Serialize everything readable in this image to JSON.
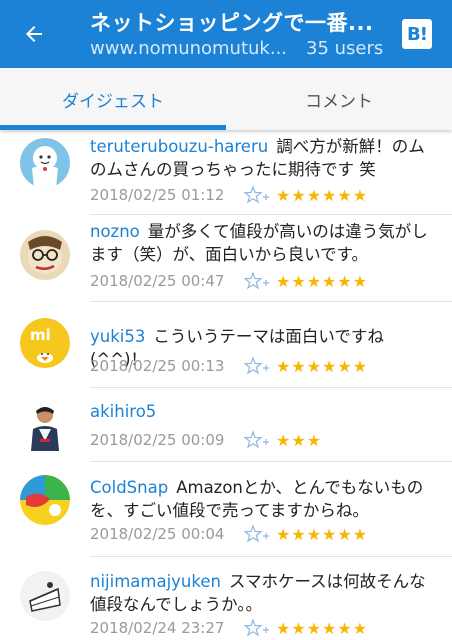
{
  "header": {
    "title": "ネットショッピングで一番...",
    "url": "www.nomunomutuk...",
    "users": "35 users",
    "hatena_button": "B!"
  },
  "tabs": [
    {
      "label": "ダイジェスト",
      "active": true
    },
    {
      "label": "コメント",
      "active": false
    }
  ],
  "colors": {
    "accent": "#1b82d6",
    "star": "#f5b800"
  },
  "comments": [
    {
      "user": "teruterubouzu-hareru",
      "text": "調べ方が新鮮！のムのムさんの買っちゃったに期待です 笑",
      "date": "2018/02/25 01:12",
      "stars": "★★★★★★",
      "star_count": 6,
      "avatar_icon": "teru-teru-bozu-avatar"
    },
    {
      "user": "nozno",
      "text": "量が多くて値段が高いのは違う気がします（笑）が、面白いから良いです。",
      "date": "2018/02/25 00:47",
      "stars": "★★★★★★",
      "star_count": 6,
      "avatar_icon": "glasses-face-avatar"
    },
    {
      "user": "yuki53",
      "text": "こういうテーマは面白いですね(^^)！",
      "date": "2018/02/25 00:13",
      "stars": "★★★★★★",
      "star_count": 6,
      "avatar_icon": "yellow-chick-avatar"
    },
    {
      "user": "akihiro5",
      "text": "",
      "date": "2018/02/25 00:09",
      "stars": "★★★",
      "star_count": 3,
      "avatar_icon": "person-avatar"
    },
    {
      "user": "ColdSnap",
      "text": "Amazonとか、とんでもないものを、すごい値段で売ってますからね。",
      "date": "2018/02/25 00:04",
      "stars": "★★★★★★",
      "star_count": 6,
      "avatar_icon": "colorful-circle-avatar"
    },
    {
      "user": "nijimamajyuken",
      "text": "スマホケースは何故そんな値段なんでしょうか。。",
      "date": "2018/02/24 23:27",
      "stars": "★★★★★★",
      "star_count": 6,
      "avatar_icon": "cake-slice-avatar"
    }
  ]
}
